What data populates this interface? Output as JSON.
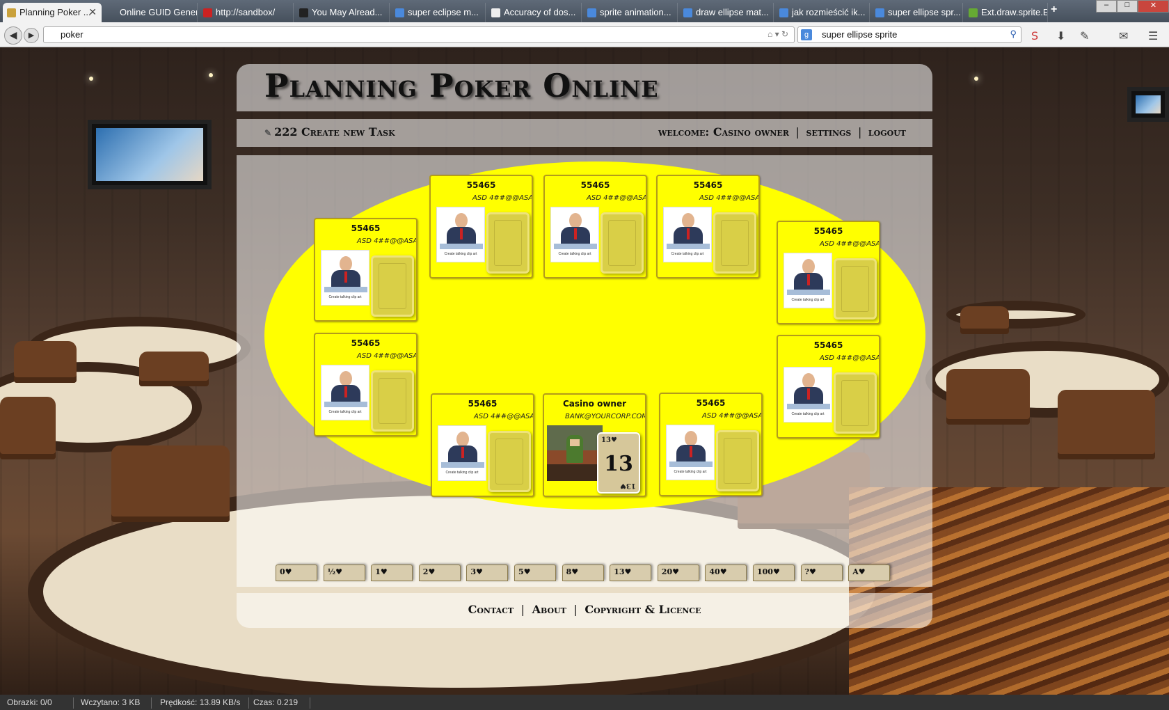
{
  "browser": {
    "tabs": [
      {
        "label": "Planning Poker ...",
        "active": true
      },
      {
        "label": "Online GUID Genera..."
      },
      {
        "label": "http://sandbox/"
      },
      {
        "label": "You May Alread..."
      },
      {
        "label": "super eclipse m..."
      },
      {
        "label": "Accuracy of dos..."
      },
      {
        "label": "sprite animation..."
      },
      {
        "label": "draw ellipse mat..."
      },
      {
        "label": "jak rozmieścić ik..."
      },
      {
        "label": "super ellipse spr..."
      },
      {
        "label": "Ext.draw.sprite.E..."
      }
    ],
    "new_tab": "+",
    "close_tab": "✕",
    "url": "poker",
    "search_query": "super ellipse sprite",
    "search_engine_icon": "g-logo"
  },
  "page": {
    "title": "Planning Poker Online",
    "task_link": "222 Create new Task",
    "welcome_label": "welcome:",
    "user_name": "Casino owner",
    "settings_link": "settings",
    "logout_link": "logout",
    "separator": "|",
    "footer": {
      "contact": "Contact",
      "about": "About",
      "copyright": "Copyright & Licence"
    }
  },
  "seats": [
    {
      "name": "55465",
      "email": "ASD 4##@@ASA",
      "avatar_caption": "Create talking clip art"
    },
    {
      "name": "55465",
      "email": "ASD 4##@@ASA",
      "avatar_caption": "Create talking clip art"
    },
    {
      "name": "55465",
      "email": "ASD 4##@@ASA",
      "avatar_caption": "Create talking clip art"
    },
    {
      "name": "55465",
      "email": "ASD 4##@@ASA",
      "avatar_caption": "Create talking clip art"
    },
    {
      "name": "55465",
      "email": "ASD 4##@@ASA",
      "avatar_caption": "Create talking clip art"
    },
    {
      "name": "55465",
      "email": "ASD 4##@@ASA",
      "avatar_caption": "Create talking clip art"
    },
    {
      "name": "55465",
      "email": "ASD 4##@@ASA",
      "avatar_caption": "Create talking clip art"
    },
    {
      "name": "55465",
      "email": "ASD 4##@@ASA",
      "avatar_caption": "Create talking clip art"
    },
    {
      "name": "55465",
      "email": "ASD 4##@@ASA",
      "avatar_caption": "Create talking clip art"
    }
  ],
  "owner_seat": {
    "name": "Casino owner",
    "email": "BANK@YOURCORP.COM",
    "card_value": "13",
    "card_corner": "13♥"
  },
  "vote_cards": [
    "0♥",
    "½♥",
    "1♥",
    "2♥",
    "3♥",
    "5♥",
    "8♥",
    "13♥",
    "20♥",
    "40♥",
    "100♥",
    "?♥",
    "A♥"
  ],
  "statusbar": {
    "images": "Obrazki: 0/0",
    "loaded": "Wczytano: 3 KB",
    "speed": "Prędkość: 13.89 KB/s",
    "time": "Czas: 0.219"
  },
  "colors": {
    "table": "#ffff00",
    "seat_border": "#b39c1b",
    "card_back": "#d9cf47"
  }
}
